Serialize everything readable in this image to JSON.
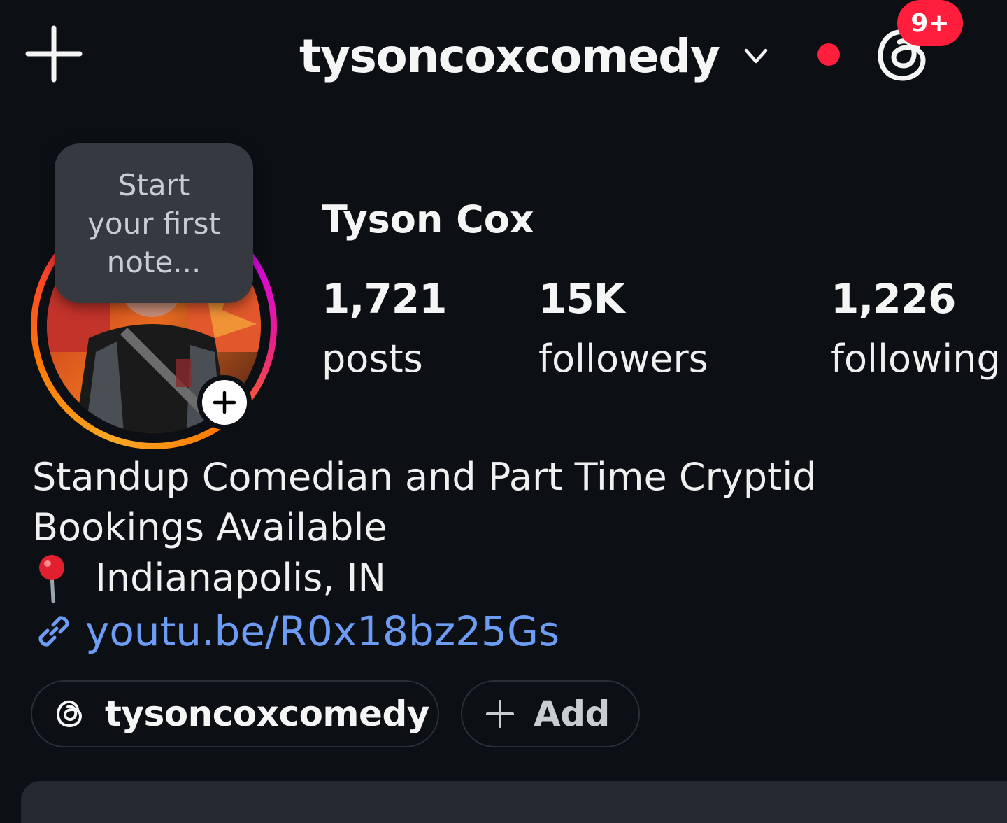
{
  "header": {
    "username": "tysoncoxcomedy",
    "create_icon": "plus-icon",
    "switcher_icon": "chevron-down-icon",
    "threads_icon": "threads-icon",
    "notification_badge": "9+"
  },
  "profile": {
    "note_prompt": "Start\nyour first\nnote...",
    "display_name": "Tyson Cox",
    "stats": {
      "posts": {
        "value": "1,721",
        "label": "posts"
      },
      "followers": {
        "value": "15K",
        "label": "followers"
      },
      "following": {
        "value": "1,226",
        "label": "following"
      }
    },
    "bio": {
      "line1": "Standup Comedian and Part Time Cryptid",
      "line2": "Bookings Available",
      "location": "Indianapolis, IN",
      "location_icon": "pin-icon",
      "link": "youtu.be/R0x18bz25Gs",
      "link_icon": "link-icon"
    },
    "pills": {
      "threads_handle": "tysoncoxcomedy",
      "add_label": "Add"
    }
  },
  "colors": {
    "background": "#0c1014",
    "badge": "#ff1f3d",
    "link": "#6d9cf5",
    "note_bubble": "#363a40"
  }
}
